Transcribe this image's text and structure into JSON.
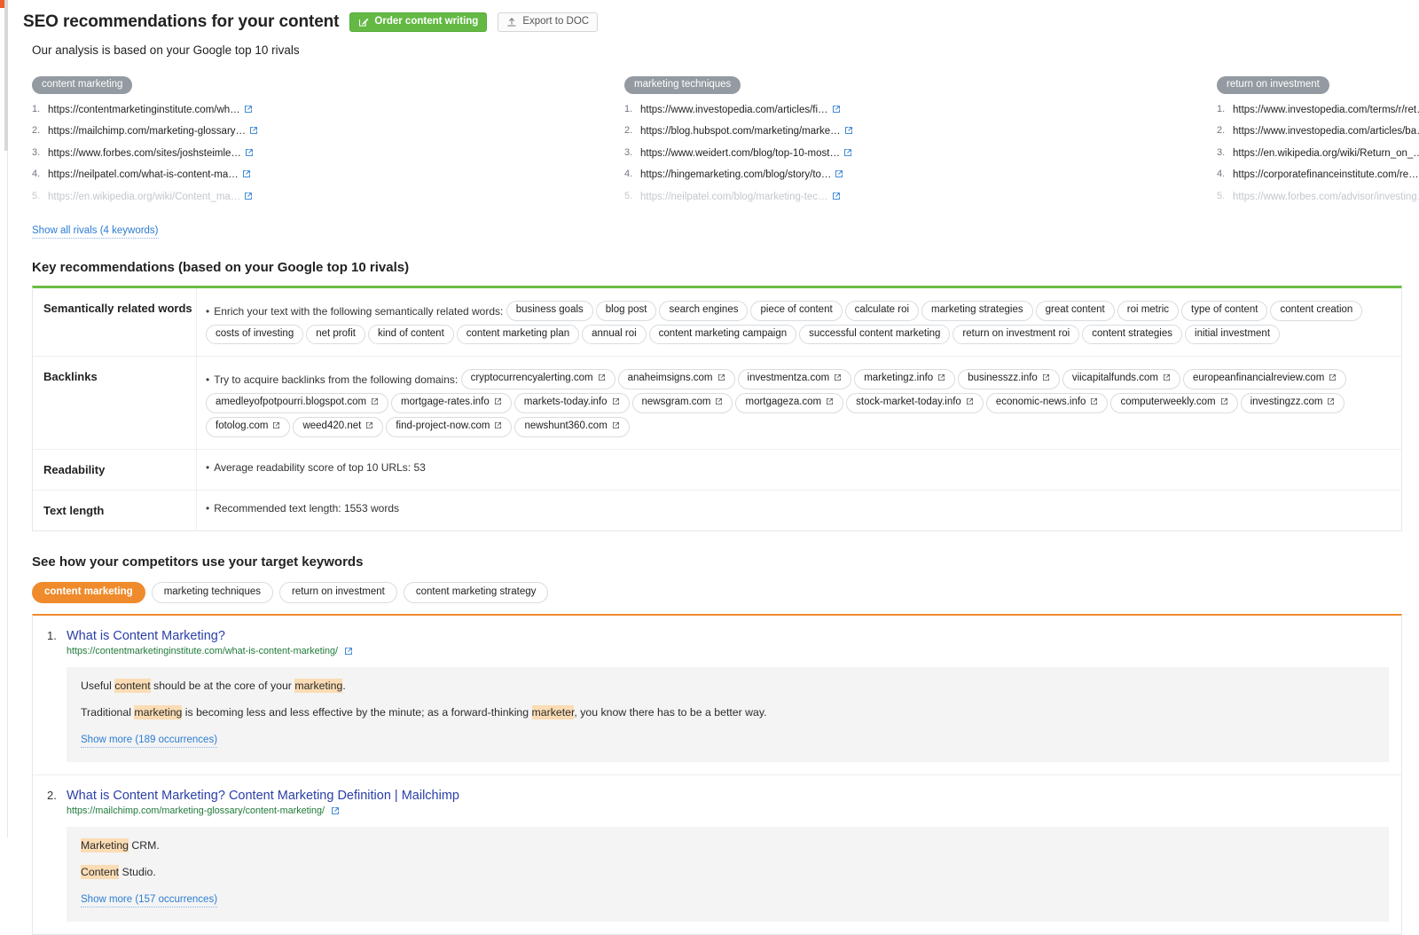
{
  "header": {
    "title": "SEO recommendations for your content",
    "order_button": "Order content writing",
    "export_button": "Export to DOC",
    "subtitle": "Our analysis is based on your Google top 10 rivals",
    "primary_color": "#63b944"
  },
  "rivals": {
    "show_all_label": "Show all rivals (4 keywords)",
    "columns": [
      {
        "keyword": "content marketing",
        "urls": [
          {
            "text": "https://contentmarketinginstitute.com/wh…",
            "muted": false
          },
          {
            "text": "https://mailchimp.com/marketing-glossary…",
            "muted": false
          },
          {
            "text": "https://www.forbes.com/sites/joshsteimle…",
            "muted": false
          },
          {
            "text": "https://neilpatel.com/what-is-content-ma…",
            "muted": false
          },
          {
            "text": "https://en.wikipedia.org/wiki/Content_ma…",
            "muted": true
          }
        ]
      },
      {
        "keyword": "marketing techniques",
        "urls": [
          {
            "text": "https://www.investopedia.com/articles/fi…",
            "muted": false
          },
          {
            "text": "https://blog.hubspot.com/marketing/marke…",
            "muted": false
          },
          {
            "text": "https://www.weidert.com/blog/top-10-most…",
            "muted": false
          },
          {
            "text": "https://hingemarketing.com/blog/story/to…",
            "muted": false
          },
          {
            "text": "https://neilpatel.com/blog/marketing-tec…",
            "muted": true
          }
        ]
      },
      {
        "keyword": "return on investment",
        "urls": [
          {
            "text": "https://www.investopedia.com/terms/r/ret…",
            "muted": false
          },
          {
            "text": "https://www.investopedia.com/articles/ba…",
            "muted": false
          },
          {
            "text": "https://en.wikipedia.org/wiki/Return_on_…",
            "muted": false
          },
          {
            "text": "https://corporatefinanceinstitute.com/re…",
            "muted": false
          },
          {
            "text": "https://www.forbes.com/advisor/investing…",
            "muted": true
          }
        ]
      }
    ]
  },
  "key_recommendations": {
    "title": "Key recommendations (based on your Google top 10 rivals)",
    "accent_color": "#6bbd44",
    "rows": [
      {
        "label": "Semantically related words",
        "lead": "Enrich your text with the following semantically related words:",
        "chips": [
          "business goals",
          "blog post",
          "search engines",
          "piece of content",
          "calculate roi",
          "marketing strategies",
          "great content",
          "roi metric",
          "type of content",
          "content creation",
          "costs of investing",
          "net profit",
          "kind of content",
          "content marketing plan",
          "annual roi",
          "content marketing campaign",
          "successful content marketing",
          "return on investment roi",
          "content strategies",
          "initial investment"
        ]
      },
      {
        "label": "Backlinks",
        "lead": "Try to acquire backlinks from the following domains:",
        "chips": [
          "cryptocurrencyalerting.com",
          "anaheimsigns.com",
          "investmentza.com",
          "marketingz.info",
          "businesszz.info",
          "viicapitalfunds.com",
          "europeanfinancialreview.com",
          "amedleyofpotpourri.blogspot.com",
          "mortgage-rates.info",
          "markets-today.info",
          "newsgram.com",
          "mortgageza.com",
          "stock-market-today.info",
          "economic-news.info",
          "computerweekly.com",
          "investingzz.com",
          "fotolog.com",
          "weed420.net",
          "find-project-now.com",
          "newshunt360.com"
        ]
      },
      {
        "label": "Readability",
        "text": "Average readability score of top 10 URLs: 53"
      },
      {
        "label": "Text length",
        "text": "Recommended text length: 1553 words"
      }
    ]
  },
  "competitors": {
    "title": "See how your competitors use your target keywords",
    "accent_color": "#ef8b2c",
    "tabs": [
      {
        "label": "content marketing",
        "active": true
      },
      {
        "label": "marketing techniques",
        "active": false
      },
      {
        "label": "return on investment",
        "active": false
      },
      {
        "label": "content marketing strategy",
        "active": false
      }
    ],
    "items": [
      {
        "num": "1.",
        "title": "What is Content Marketing?",
        "url": "https://contentmarketinginstitute.com/what-is-content-marketing/",
        "paragraphs": [
          [
            {
              "t": "Useful ",
              "hl": false
            },
            {
              "t": "content",
              "hl": true
            },
            {
              "t": " should be at the core of your ",
              "hl": false
            },
            {
              "t": "marketing",
              "hl": true
            },
            {
              "t": ".",
              "hl": false
            }
          ],
          [
            {
              "t": "Traditional ",
              "hl": false
            },
            {
              "t": "marketing",
              "hl": true
            },
            {
              "t": " is becoming less and less effective by the minute; as a forward-thinking ",
              "hl": false
            },
            {
              "t": "marketer",
              "hl": true
            },
            {
              "t": ", you know there has to be a better way.",
              "hl": false
            }
          ]
        ],
        "show_more": "Show more (189 occurrences)"
      },
      {
        "num": "2.",
        "title": "What is Content Marketing? Content Marketing Definition | Mailchimp",
        "url": "https://mailchimp.com/marketing-glossary/content-marketing/",
        "paragraphs": [
          [
            {
              "t": "Marketing",
              "hl": true
            },
            {
              "t": " CRM.",
              "hl": false
            }
          ],
          [
            {
              "t": "Content",
              "hl": true
            },
            {
              "t": " Studio.",
              "hl": false
            }
          ]
        ],
        "show_more": "Show more (157 occurrences)"
      }
    ]
  },
  "icons": {
    "external_link": "external-link-icon",
    "order": "pencil-square-icon",
    "export": "upload-icon"
  }
}
